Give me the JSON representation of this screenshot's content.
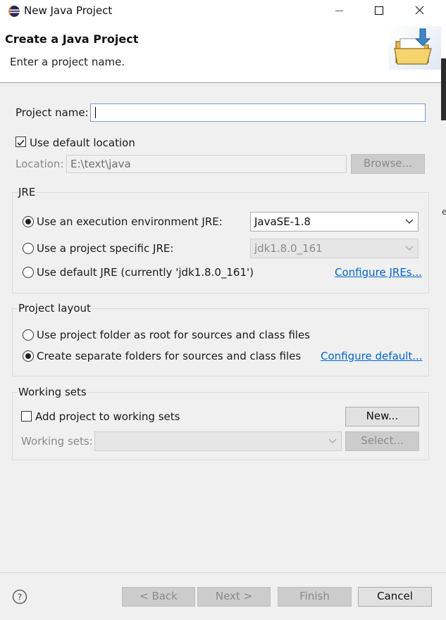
{
  "window": {
    "title": "New Java Project",
    "icons": [
      "eclipse-icon",
      "minimize-icon",
      "maximize-icon",
      "close-icon"
    ]
  },
  "header": {
    "title": "Create a Java Project",
    "subtitle": "Enter a project name.",
    "graphic": "new-folder-wizard-icon"
  },
  "project_name": {
    "label": "Project name:",
    "value": ""
  },
  "location": {
    "use_default_label": "Use default location",
    "use_default_checked": true,
    "label": "Location:",
    "value": "E:\\text\\java",
    "browse_label": "Browse..."
  },
  "jre": {
    "group_label": "JRE",
    "options": [
      {
        "label": "Use an execution environment JRE:",
        "selected": true,
        "combo_value": "JavaSE-1.8",
        "combo_enabled": true
      },
      {
        "label": "Use a project specific JRE:",
        "selected": false,
        "combo_value": "jdk1.8.0_161",
        "combo_enabled": false
      },
      {
        "label": "Use default JRE (currently 'jdk1.8.0_161')",
        "selected": false
      }
    ],
    "configure_link": "Configure JREs..."
  },
  "layout": {
    "group_label": "Project layout",
    "options": [
      {
        "label": "Use project folder as root for sources and class files",
        "selected": false
      },
      {
        "label": "Create separate folders for sources and class files",
        "selected": true
      }
    ],
    "configure_link": "Configure default..."
  },
  "working_sets": {
    "group_label": "Working sets",
    "add_label": "Add project to working sets",
    "add_checked": false,
    "new_label": "New...",
    "sets_label": "Working sets:",
    "select_label": "Select..."
  },
  "footer": {
    "help_icon": "help-icon",
    "back_label": "< Back",
    "next_label": "Next >",
    "finish_label": "Finish",
    "cancel_label": "Cancel"
  },
  "stray_text": "e"
}
